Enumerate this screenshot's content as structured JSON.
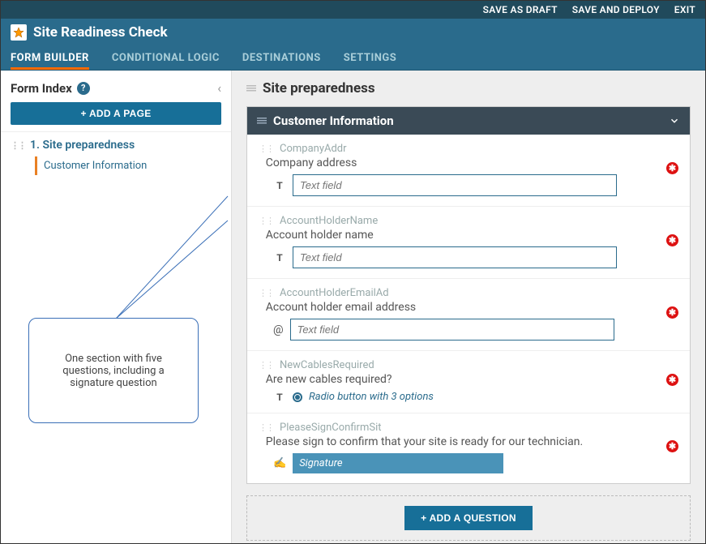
{
  "topbar": {
    "save_draft": "SAVE AS DRAFT",
    "save_deploy": "SAVE AND DEPLOY",
    "exit": "EXIT"
  },
  "title": "Site Readiness Check",
  "tabs": {
    "form_builder": "FORM BUILDER",
    "conditional_logic": "CONDITIONAL LOGIC",
    "destinations": "DESTINATIONS",
    "settings": "SETTINGS"
  },
  "sidebar": {
    "index_label": "Form Index",
    "add_page": "+ ADD A PAGE",
    "page1": "1. Site preparedness",
    "section1": "Customer Information",
    "callout": "One section with five questions, including a signature question"
  },
  "main": {
    "page_title": "Site preparedness",
    "section_title": "Customer Information",
    "add_question": "+ ADD A QUESTION",
    "questions": [
      {
        "id": "CompanyAddr",
        "label": "Company address",
        "field_type": "text",
        "placeholder": "Text field"
      },
      {
        "id": "AccountHolderName",
        "label": "Account holder name",
        "field_type": "text",
        "placeholder": "Text field"
      },
      {
        "id": "AccountHolderEmailAd",
        "label": "Account holder email address",
        "field_type": "email",
        "placeholder": "Text field"
      },
      {
        "id": "NewCablesRequired",
        "label": "Are new cables required?",
        "field_type": "radio",
        "hint": "Radio button with 3 options"
      },
      {
        "id": "PleaseSignConfirmSit",
        "label": "Please sign to confirm that your site is ready for our technician.",
        "field_type": "signature",
        "placeholder": "Signature"
      }
    ]
  }
}
